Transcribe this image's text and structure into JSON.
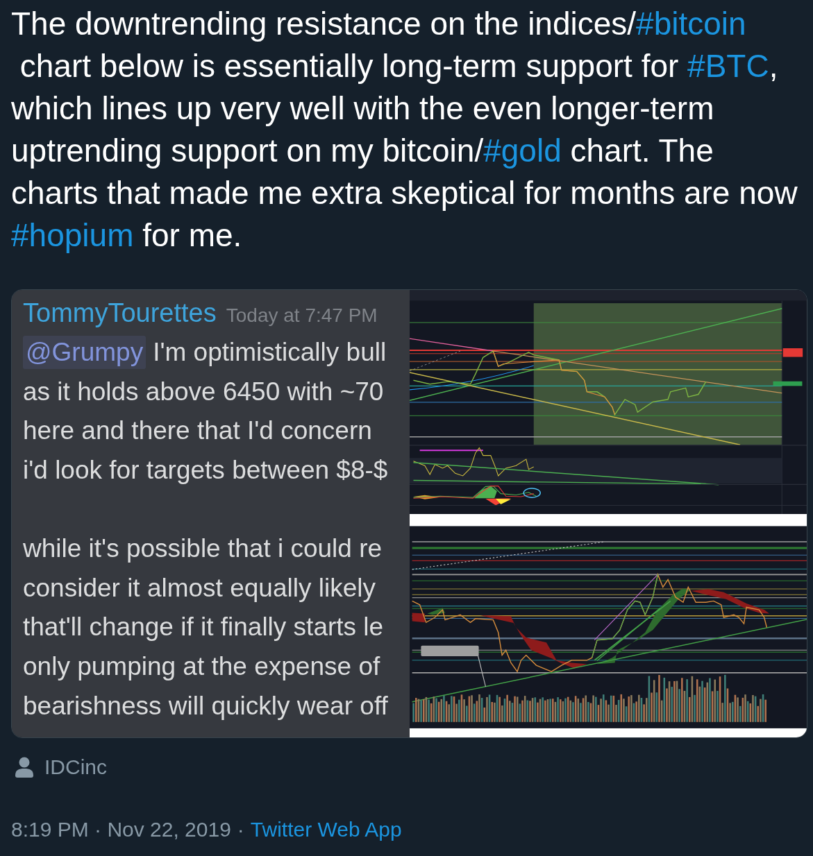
{
  "tweet": {
    "segments": [
      {
        "kind": "text",
        "text": "The downtrending resistance on the indices/"
      },
      {
        "kind": "hashtag",
        "text": "#bitcoin"
      },
      {
        "kind": "text",
        "text": "\n chart below is essentially long-term support for "
      },
      {
        "kind": "hashtag",
        "text": "#BTC"
      },
      {
        "kind": "text",
        "text": ",\nwhich lines up very well with the even longer-term\nuptrending support on my bitcoin/"
      },
      {
        "kind": "hashtag",
        "text": "#gold"
      },
      {
        "kind": "text",
        "text": " chart. The\ncharts that made me extra skeptical for months are now\n"
      },
      {
        "kind": "hashtag",
        "text": "#hopium"
      },
      {
        "kind": "text",
        "text": " for me."
      }
    ]
  },
  "media": {
    "chat": {
      "author": "TommyTourettes",
      "timestamp": "Today at 7:47 PM",
      "mention": "@Grumpy",
      "paragraphs": [
        {
          "lines": [
            "I'm optimistically bull",
            "as it holds above 6450 with ~70",
            "here and there that I'd concern",
            "i'd look for targets between $8-$"
          ]
        },
        {
          "lines": [
            "while it's possible that i could re",
            "consider it almost equally likely",
            "that'll change if it finally starts le",
            "only pumping at the expense of",
            "bearishness will quickly wear off"
          ]
        }
      ]
    },
    "chart_images": [
      {
        "kind": "indicators"
      },
      {
        "kind": "volume"
      }
    ]
  },
  "tagged_user": "IDCinc",
  "footer": {
    "time_date": "8:19 PM · Nov 22, 2019",
    "separator": "·",
    "source": "Twitter Web App"
  }
}
